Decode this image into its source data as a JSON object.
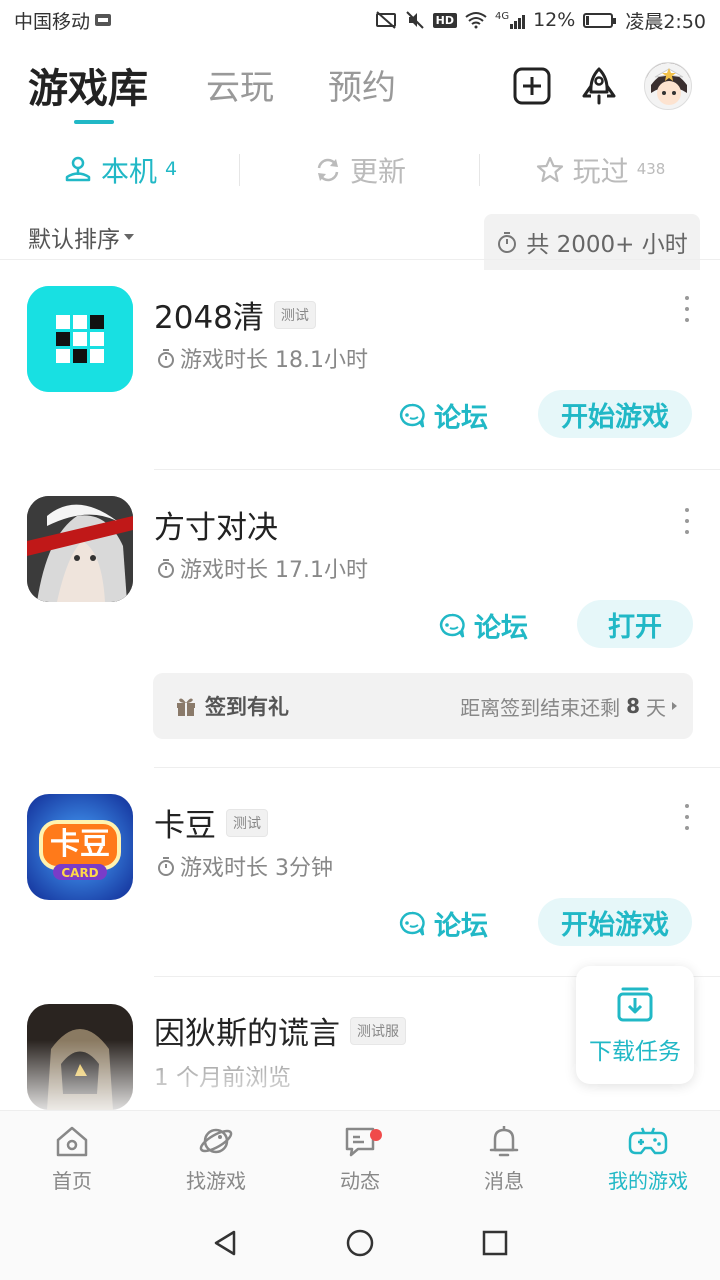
{
  "status_bar": {
    "carrier": "中国移动",
    "hd": "HD",
    "network": "4G",
    "battery": "12%",
    "battery_level": 0.12,
    "time": "凌晨2:50"
  },
  "header": {
    "tabs": [
      {
        "label": "游戏库",
        "active": true
      },
      {
        "label": "云玩",
        "active": false
      },
      {
        "label": "预约",
        "active": false
      }
    ],
    "icons": [
      "add-icon",
      "rocket-icon",
      "avatar"
    ]
  },
  "subtabs": [
    {
      "label": "本机",
      "count": "4",
      "icon": "device-icon",
      "active": true
    },
    {
      "label": "更新",
      "count": "",
      "icon": "refresh-icon",
      "active": false
    },
    {
      "label": "玩过",
      "count": "438",
      "icon": "star-icon",
      "active": false
    }
  ],
  "sort": {
    "label": "默认排序",
    "total": "共 2000+ 小时"
  },
  "games": [
    {
      "name": "2048清",
      "tag": "测试",
      "meta": "游戏时长 18.1小时",
      "forum": "论坛",
      "action": "开始游戏"
    },
    {
      "name": "方寸对决",
      "tag": "",
      "meta": "游戏时长 17.1小时",
      "forum": "论坛",
      "action": "打开",
      "signin": {
        "label": "签到有礼",
        "prefix": "距离签到结束还剩",
        "days": "8",
        "suffix": "天"
      }
    },
    {
      "name": "卡豆",
      "tag": "测试",
      "meta": "游戏时长 3分钟",
      "forum": "论坛",
      "action": "开始游戏"
    },
    {
      "name": "因狄斯的谎言",
      "tag": "测试服",
      "meta": "1 个月前浏览"
    }
  ],
  "download_fab": {
    "label": "下载任务"
  },
  "bottom_nav": [
    {
      "label": "首页",
      "icon": "home-icon",
      "active": false
    },
    {
      "label": "找游戏",
      "icon": "planet-icon",
      "active": false
    },
    {
      "label": "动态",
      "icon": "chat-icon",
      "active": false,
      "badge": true
    },
    {
      "label": "消息",
      "icon": "bell-icon",
      "active": false
    },
    {
      "label": "我的游戏",
      "icon": "gamepad-icon",
      "active": true
    }
  ],
  "colors": {
    "accent": "#21b8c6",
    "accent_bg": "#e6f7f9",
    "badge": "#f04a4a"
  }
}
